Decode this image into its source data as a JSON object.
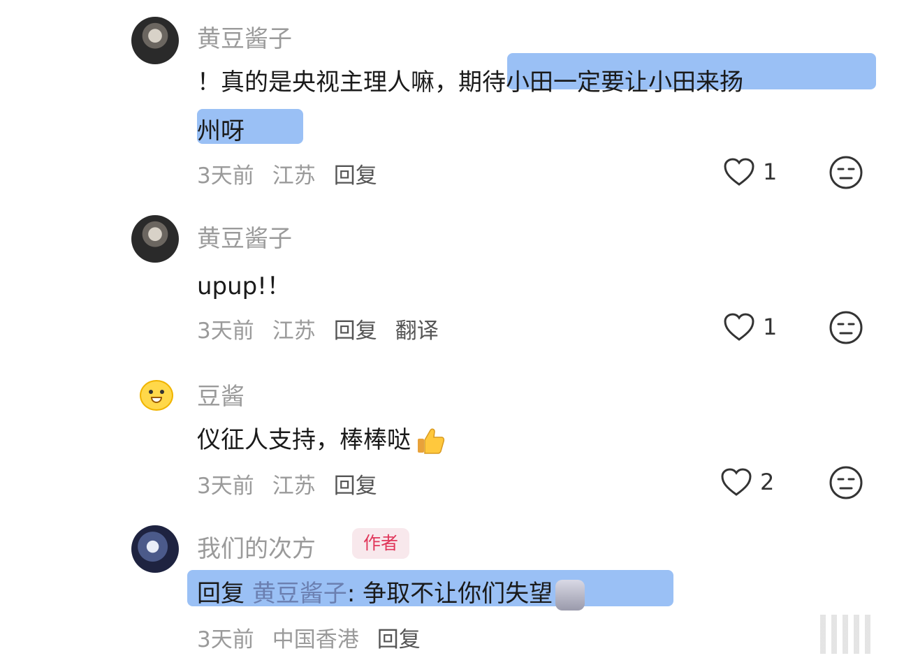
{
  "comments": [
    {
      "username": "黄豆酱子",
      "text_plain": "！真的是央视主理人嘛，",
      "text_highlight_1": "期待小田一定要让小田来扬",
      "text_highlight_2": "州呀",
      "time": "3天前",
      "location": "江苏",
      "reply_label": "回复",
      "likes": "1",
      "avatar_icon": "user-avatar-dark"
    },
    {
      "username": "黄豆酱子",
      "text": "upup!！",
      "time": "3天前",
      "location": "江苏",
      "reply_label": "回复",
      "translate_label": "翻译",
      "likes": "1",
      "avatar_icon": "user-avatar-dark"
    },
    {
      "username": "豆酱",
      "text": "仪征人支持，棒棒哒",
      "emoji_icon": "thumbs-up-icon",
      "time": "3天前",
      "location": "江苏",
      "reply_label": "回复",
      "likes": "2",
      "avatar_icon": "laughing-emoji-avatar"
    },
    {
      "username": "我们的次方",
      "author_tag": "作者",
      "reply_prefix": "回复",
      "reply_to": "黄豆酱子",
      "text": ": 争取不让你们失望",
      "time": "3天前",
      "location": "中国香港",
      "reply_label": "回复",
      "avatar_icon": "anime-avatar"
    }
  ],
  "colors": {
    "highlight": "#8fb9f4",
    "author_tag_bg": "#f8e8ec",
    "author_tag_text": "#e0365a",
    "meta_gray": "#9a9a9a"
  }
}
